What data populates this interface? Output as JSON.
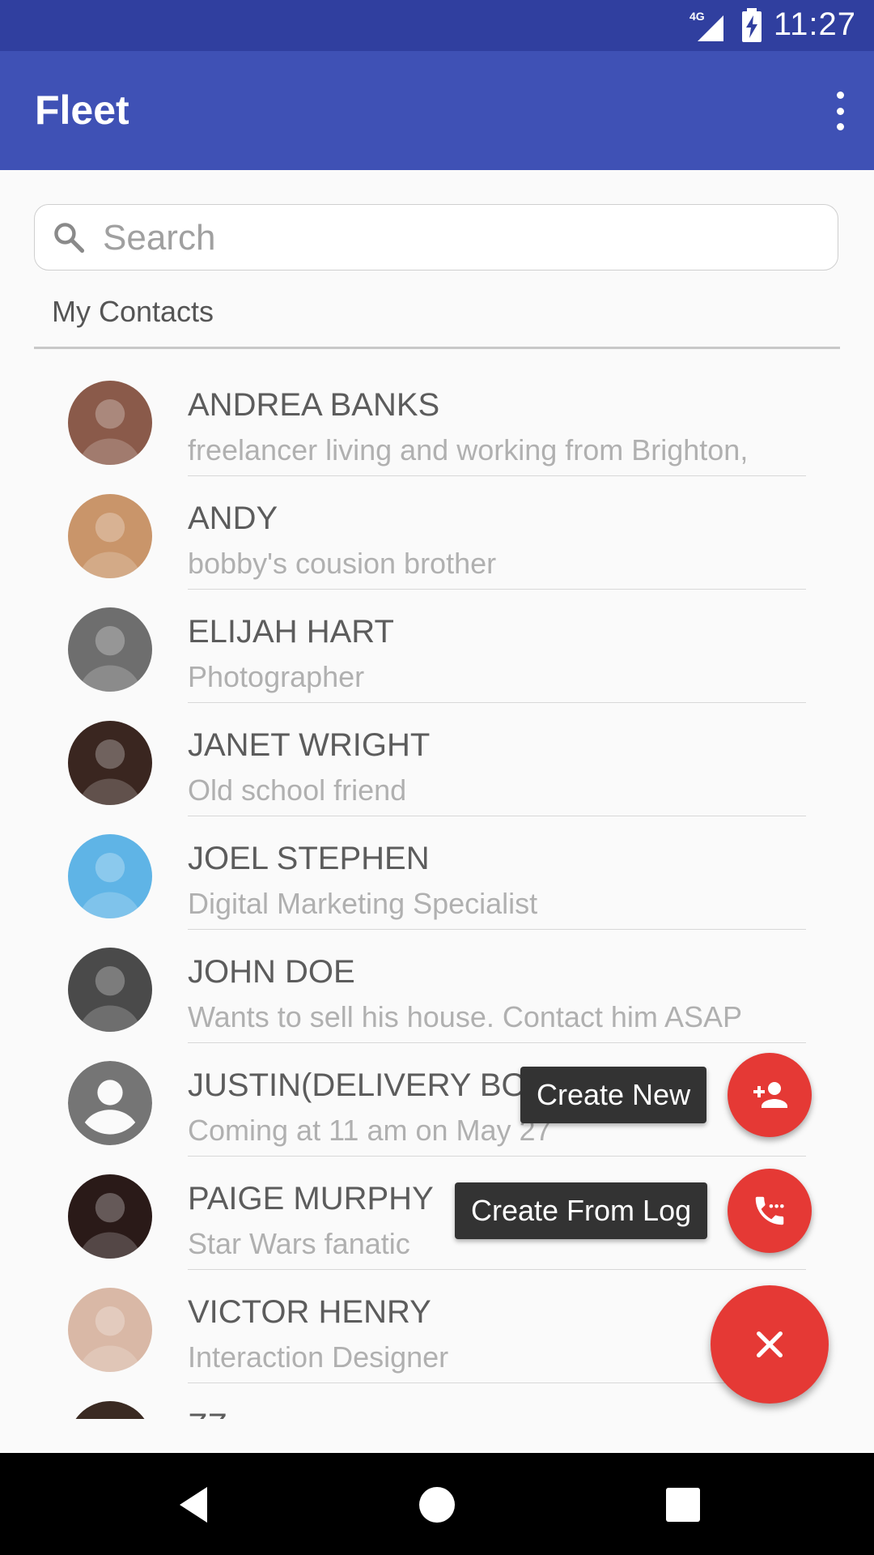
{
  "status_bar": {
    "network": "4G",
    "time": "11:27"
  },
  "app_bar": {
    "title": "Fleet"
  },
  "search": {
    "placeholder": "Search",
    "value": ""
  },
  "section": {
    "label": "My Contacts"
  },
  "contacts": [
    {
      "name": "ANDREA BANKS",
      "desc": "freelancer living and working from Brighton,",
      "avatar_color": "#8a5a4a"
    },
    {
      "name": "ANDY",
      "desc": "bobby's cousion brother",
      "avatar_color": "#c9956a"
    },
    {
      "name": "ELIJAH HART",
      "desc": "Photographer",
      "avatar_color": "#6e6e6e"
    },
    {
      "name": "JANET WRIGHT",
      "desc": "Old school friend",
      "avatar_color": "#3a2620"
    },
    {
      "name": "JOEL STEPHEN",
      "desc": "Digital Marketing Specialist",
      "avatar_color": "#5fb4e6"
    },
    {
      "name": "JOHN DOE",
      "desc": "Wants to sell his house. Contact him ASAP",
      "avatar_color": "#4a4a4a"
    },
    {
      "name": "JUSTIN(DELIVERY BOY)",
      "desc": "Coming at 11 am on May 27",
      "avatar_color": "#757575"
    },
    {
      "name": "PAIGE MURPHY",
      "desc": "Star Wars fanatic",
      "avatar_color": "#2a1a18"
    },
    {
      "name": "VICTOR HENRY",
      "desc": "Interaction Designer",
      "avatar_color": "#d9b8a6"
    },
    {
      "name": "ZZ",
      "desc": "",
      "avatar_color": "#3a2a22"
    }
  ],
  "fab_menu": {
    "create_new": "Create New",
    "create_from_log": "Create From Log"
  },
  "colors": {
    "status_bar": "#303f9f",
    "app_bar": "#3f51b5",
    "fab": "#e53935"
  }
}
